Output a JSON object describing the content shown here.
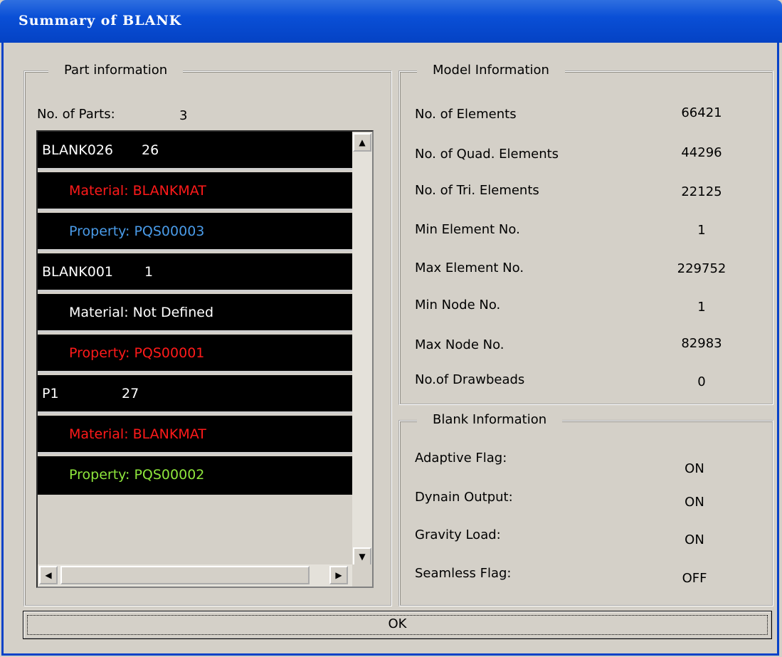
{
  "window": {
    "title": "Summary of BLANK"
  },
  "part_info": {
    "legend": "Part information",
    "num_parts_label": "No. of Parts:",
    "num_parts_value": "3",
    "rows": [
      {
        "name": "BLANK026",
        "id": "26",
        "kind": "part"
      },
      {
        "text": "Material: BLANKMAT",
        "color": "#ff1a1a"
      },
      {
        "text": "Property: PQS00003",
        "color": "#4a9be8"
      },
      {
        "name": "BLANK001",
        "id": "1",
        "kind": "part"
      },
      {
        "text": "Material:  Not Defined",
        "color": "#ffffff"
      },
      {
        "text": "Property: PQS00001",
        "color": "#ff1a1a"
      },
      {
        "name": "P1",
        "id": "27",
        "kind": "part"
      },
      {
        "text": "Material: BLANKMAT",
        "color": "#ff1a1a"
      },
      {
        "text": "Property: PQS00002",
        "color": "#8ee63c"
      }
    ]
  },
  "model_info": {
    "legend": "Model Information",
    "rows": [
      {
        "label": "No. of Elements",
        "value": "66421"
      },
      {
        "label": "No. of Quad. Elements",
        "value": "44296"
      },
      {
        "label": "No. of Tri. Elements",
        "value": "22125"
      },
      {
        "label": "Min Element No.",
        "value": "1"
      },
      {
        "label": "Max Element No.",
        "value": "229752"
      },
      {
        "label": "Min Node No.",
        "value": "1"
      },
      {
        "label": "Max Node No.",
        "value": "82983"
      },
      {
        "label": "No.of Drawbeads",
        "value": "0"
      }
    ]
  },
  "blank_info": {
    "legend": "Blank Information",
    "rows": [
      {
        "label": "Adaptive Flag:",
        "value": "ON"
      },
      {
        "label": "Dynain Output:",
        "value": "ON"
      },
      {
        "label": "Gravity Load:",
        "value": "ON"
      },
      {
        "label": "Seamless Flag:",
        "value": "OFF"
      }
    ]
  },
  "ok_label": "OK"
}
